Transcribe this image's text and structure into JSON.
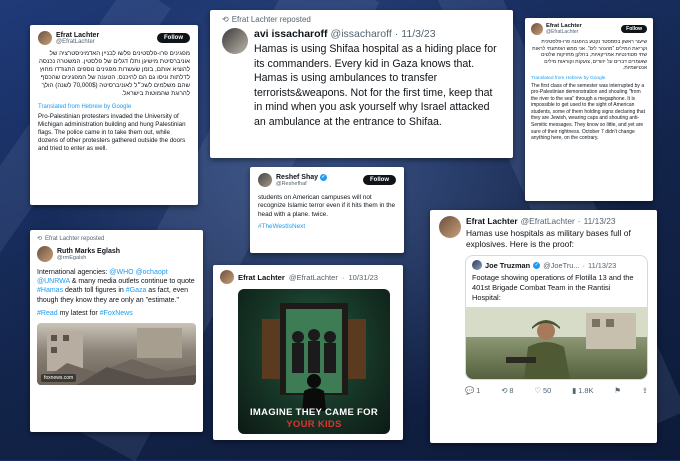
{
  "card1": {
    "name": "Efrat Lachter",
    "handle": "@EfratLachter",
    "follow": "Follow",
    "hebrew": "מפגינים פרו-פלסטינים פלשו לבניין האדמיניסטרציה של אוניברסיטת מישיגן ותלו דגלים של פלסטין. המשטרה נכנסה להוציא אותם, בזמן שעשרות מפגינים נוספים התגודדו מחוץ לדלתות וניסו גם הם להיכנס. הטענה של המפגינים שהכסף שהם משלמים לשכ״ל לאוניברסיטה (70,000$ לשנה) הולך להרוגת שהמוטות בישראל.",
    "translated": "Translated from Hebrew by Google",
    "english": "Pro-Palestinian protesters invaded the University of Michigan administration building and hung Palestinian flags. The police came in to take them out, while dozens of other protesters gathered outside the doors and tried to enter as well."
  },
  "card2": {
    "repost": "Efrat Lachter reposted",
    "name": "avi issacharoff",
    "handle": "@issacharoff",
    "date": "11/3/23",
    "text": "Hamas is using Shifaa hospital as a hiding place for its commanders. Every kid in Gaza knows that. Hamas is using ambulances to transfer terrorists&weapons. Not for the first time, keep that in mind when you ask yourself why Israel attacked an ambulance at the entrance to Shifaa."
  },
  "card3": {
    "name": "Efrat Lachter",
    "handle": "@EfratLachter",
    "follow": "Follow",
    "hebrew": "שיעור ראשון בסמסטר נקטע בהפגנה פרו-פלסטינית וקריאת המילים \"מהנהר לים\". אני ממש הופתעתי לראות שתי סטודנטיות אמריקאיות, בחלקן מחזיקות שלטים שאומרים דברים על יהודים, צועקות וקוראות מילים אנטישמיות.",
    "translated": "Translated from Hebrew by Google",
    "english": "The first class of the semester was interrupted by a pro-Palestinian demonstration and shouting \"from the river to the sea\" through a megaphone. It is impossible to get used to the sight of American students, some of them holding signs declaring that they are Jewish, wearing caps and shouting anti-Semitic messages. They know so little, and yet are sure of their rightness. October 7 didn't change anything here, on the contrary."
  },
  "card4": {
    "name": "Reshef Shay",
    "handle": "@Reshefhaf",
    "follow": "Follow",
    "text": "students on American campuses will not recognize Islamic terror even if it hits them in the head with a plane. twice.",
    "hashtag": "#TheWestIsNext"
  },
  "card5": {
    "repost": "Efrat Lachter reposted",
    "name": "Ruth Marks Eglash",
    "handle": "@rmEgalsh",
    "text_pre": "International agencies: ",
    "mention1": "@WHO",
    "space1": " ",
    "mention2": "@ochaopt",
    "space2": " ",
    "mention3": "@UNRWA",
    "text_mid1": " & many media outlets continue to quote ",
    "hashtag1": "#Hamas",
    "text_mid2": " death toll figures in ",
    "hashtag2": "#Gaza",
    "text_end": " as fact, even though they know they are only an \"estimate.\"",
    "read_pre": "#Read",
    "read_mid": " my latest for ",
    "read_tag": "#FoxNews",
    "image_caption": "foxnews.com"
  },
  "card6": {
    "name": "Efrat Lachter",
    "handle": "@EfratLachter",
    "date": "10/31/23",
    "poster_line1": "IMAGINE THEY CAME FOR",
    "poster_line2": "YOUR KIDS"
  },
  "card7": {
    "name": "Efrat Lachter",
    "handle": "@EfratLachter",
    "date": "11/13/23",
    "text": "Hamas use hospitals as military bases full of explosives. Here is the proof:",
    "quote_name": "Joe Truzman",
    "quote_handle": "@JoeTru...",
    "quote_date": "11/13/23",
    "quote_text": "Footage showing operations of Flotilla 13 and the 401st Brigade Combat Team in the Rantisi Hospital:",
    "replies": "1",
    "reposts": "8",
    "likes": "50",
    "views": "1.8K"
  }
}
